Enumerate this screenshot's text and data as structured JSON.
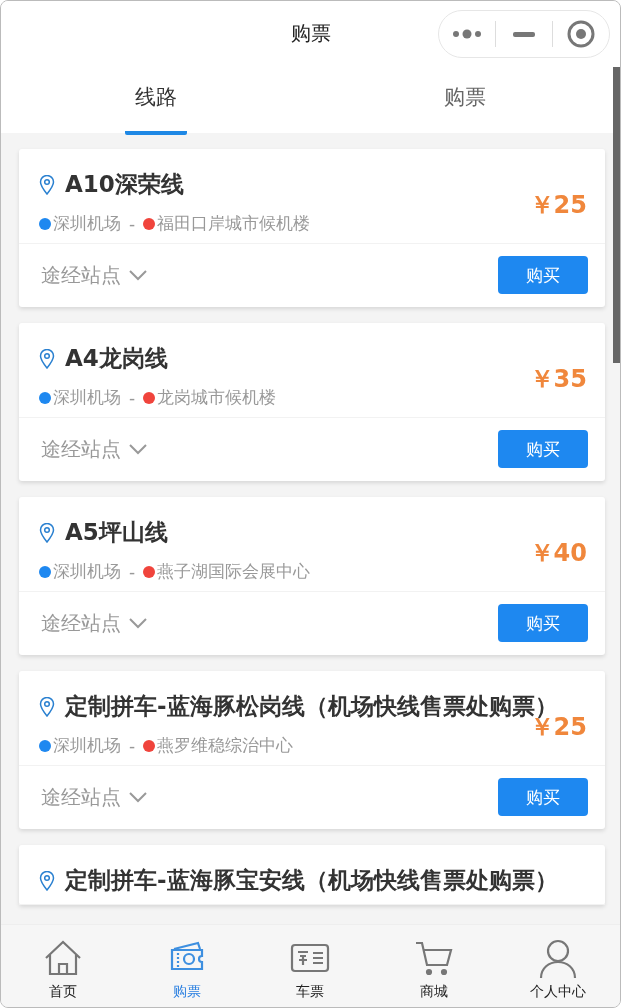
{
  "header": {
    "title": "购票"
  },
  "tabs": [
    {
      "label": "线路",
      "selected": true
    },
    {
      "label": "购票",
      "selected": false
    }
  ],
  "routes": [
    {
      "name": "A10深荣线",
      "from": "深圳机场",
      "separator": "-",
      "to": "福田口岸城市候机楼",
      "price": "￥25",
      "stops_label": "途经站点",
      "buy_label": "购买"
    },
    {
      "name": "A4龙岗线",
      "from": "深圳机场",
      "separator": "-",
      "to": "龙岗城市候机楼",
      "price": "￥35",
      "stops_label": "途经站点",
      "buy_label": "购买"
    },
    {
      "name": "A5坪山线",
      "from": "深圳机场",
      "separator": "-",
      "to": "燕子湖国际会展中心",
      "price": "￥40",
      "stops_label": "途经站点",
      "buy_label": "购买"
    },
    {
      "name": "定制拼车-蓝海豚松岗线（机场快线售票处购票）",
      "from": "深圳机场",
      "separator": "-",
      "to": "燕罗维稳综治中心",
      "price": "￥25",
      "stops_label": "途经站点",
      "buy_label": "购买"
    },
    {
      "name": "定制拼车-蓝海豚宝安线（机场快线售票处购票）"
    }
  ],
  "tab_bar": [
    {
      "label": "首页",
      "kind": "home",
      "selected": false
    },
    {
      "label": "购票",
      "kind": "buy",
      "selected": true
    },
    {
      "label": "车票",
      "kind": "ticket",
      "selected": false
    },
    {
      "label": "商城",
      "kind": "cart",
      "selected": false
    },
    {
      "label": "个人中心",
      "kind": "user",
      "selected": false
    }
  ]
}
